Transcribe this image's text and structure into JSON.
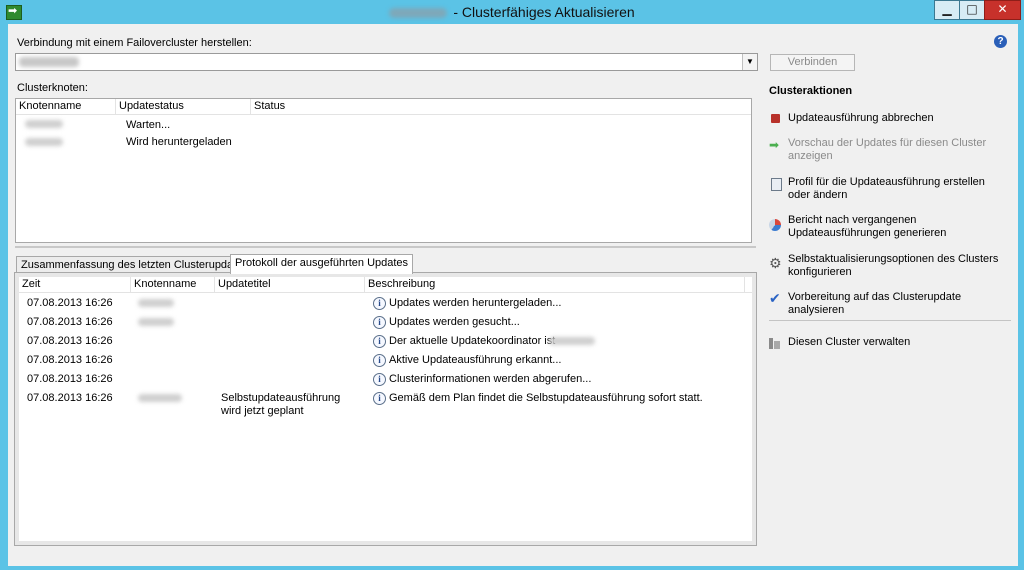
{
  "window": {
    "title": "- Clusterfähiges Aktualisieren",
    "buttons": {
      "minimize": "▁",
      "maximize": "□",
      "close": "✕"
    }
  },
  "connect": {
    "label": "Verbindung mit einem Failovercluster herstellen:",
    "button": "Verbinden"
  },
  "nodes": {
    "label": "Clusterknoten:",
    "columns": [
      "Knotenname",
      "Updatestatus",
      "Status"
    ],
    "rows": [
      {
        "status": "Warten..."
      },
      {
        "status": "Wird heruntergeladen"
      }
    ]
  },
  "tabs": {
    "summary": "Zusammenfassung des letzten Clusterupdates",
    "log": "Protokoll der ausgeführten Updates"
  },
  "log": {
    "columns": [
      "Zeit",
      "Knotenname",
      "Updatetitel",
      "Beschreibung"
    ],
    "rows": [
      {
        "time": "07.08.2013 16:26",
        "title": "",
        "desc": "Updates werden heruntergeladen..."
      },
      {
        "time": "07.08.2013 16:26",
        "title": "",
        "desc": "Updates werden gesucht..."
      },
      {
        "time": "07.08.2013 16:26",
        "title": "",
        "desc": "Der aktuelle Updatekoordinator ist"
      },
      {
        "time": "07.08.2013 16:26",
        "title": "",
        "desc": "Aktive Updateausführung erkannt..."
      },
      {
        "time": "07.08.2013 16:26",
        "title": "",
        "desc": "Clusterinformationen werden abgerufen..."
      },
      {
        "time": "07.08.2013 16:26",
        "title": "Selbstupdateausführung wird jetzt geplant",
        "desc": "Gemäß dem Plan findet die Selbstupdateausführung sofort statt."
      }
    ]
  },
  "actions": {
    "title": "Clusteraktionen",
    "items": [
      {
        "label": "Updateausführung abbrechen",
        "icon": "stop-icon"
      },
      {
        "label": "Vorschau der Updates für diesen Cluster anzeigen",
        "icon": "arrow-right-icon"
      },
      {
        "label": "Profil für die Updateausführung erstellen oder ändern",
        "icon": "document-icon"
      },
      {
        "label": "Bericht nach vergangenen Updateausführungen generieren",
        "icon": "chart-icon"
      },
      {
        "label": "Selbstaktualisierungsoptionen des Clusters konfigurieren",
        "icon": "gear-icon"
      },
      {
        "label": "Vorbereitung auf das Clusterupdate analysieren",
        "icon": "checkmark-icon"
      },
      {
        "label": "Diesen Cluster verwalten",
        "icon": "cluster-icon"
      }
    ]
  },
  "help": "?"
}
